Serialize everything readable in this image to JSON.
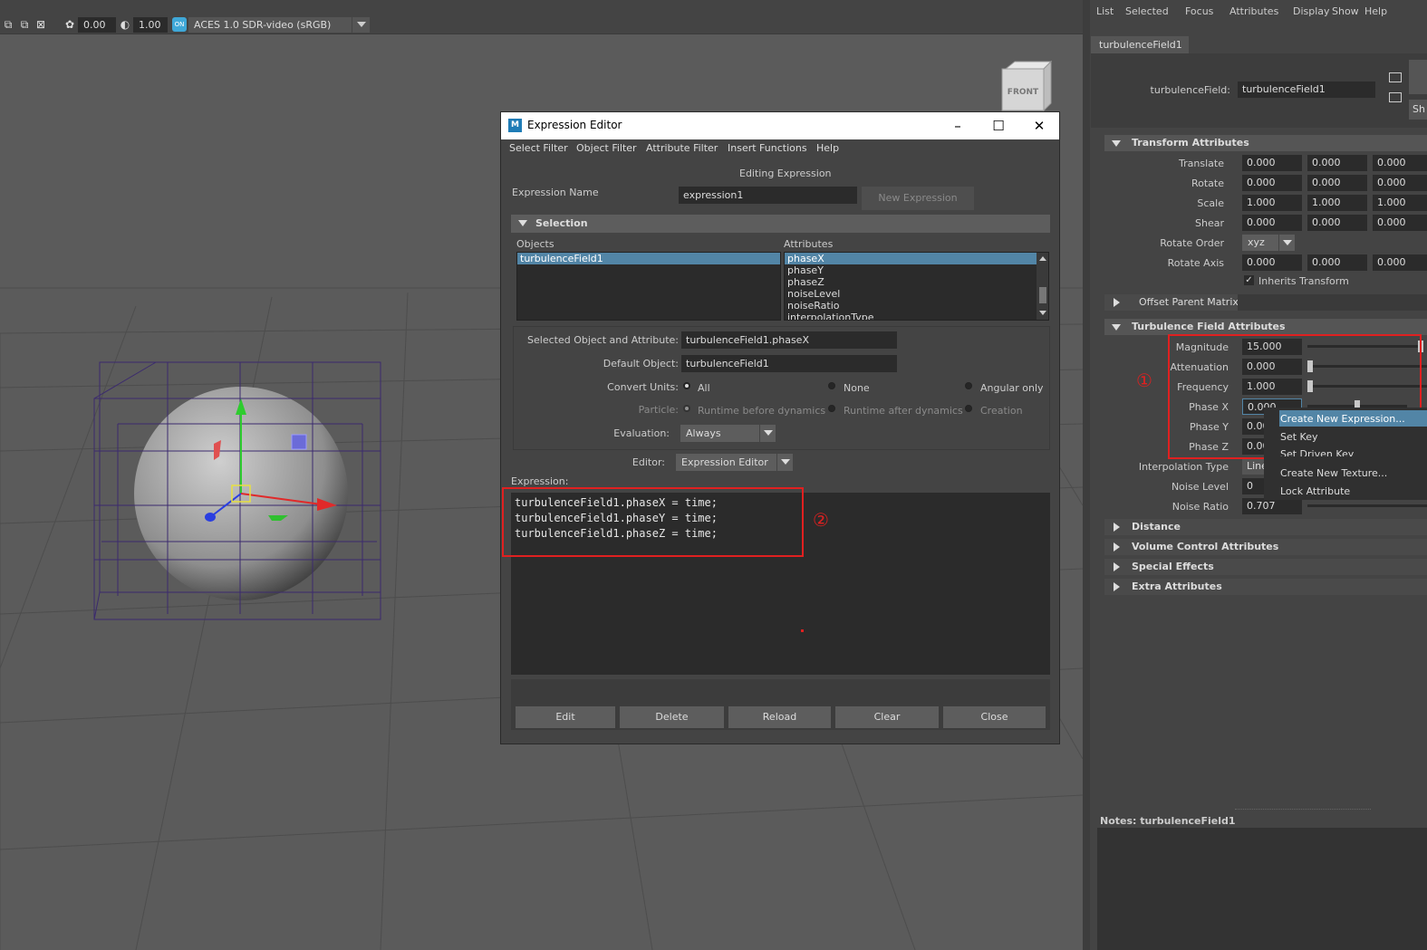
{
  "viewport": {
    "toolbar": {
      "exposure_value": "0.00",
      "gamma_value": "1.00",
      "color_space": "ACES 1.0 SDR-video (sRGB)"
    },
    "view_cube_label": "FRONT"
  },
  "expression_editor": {
    "title": "Expression Editor",
    "menu": [
      "Select Filter",
      "Object Filter",
      "Attribute Filter",
      "Insert Functions",
      "Help"
    ],
    "editing_label": "Editing Expression",
    "expression_name_label": "Expression Name",
    "expression_name_value": "expression1",
    "new_expression_button": "New Expression",
    "selection_section": "Selection",
    "objects_label": "Objects",
    "attributes_label": "Attributes",
    "objects": [
      "turbulenceField1"
    ],
    "attributes": [
      "phaseX",
      "phaseY",
      "phaseZ",
      "noiseLevel",
      "noiseRatio",
      "interpolationType"
    ],
    "selected_obj_attr_label": "Selected Object and Attribute:",
    "selected_obj_attr_value": "turbulenceField1.phaseX",
    "default_object_label": "Default Object:",
    "default_object_value": "turbulenceField1",
    "convert_units_label": "Convert Units:",
    "convert_units_options": [
      "All",
      "None",
      "Angular only"
    ],
    "particle_label": "Particle:",
    "particle_options": [
      "Runtime before dynamics",
      "Runtime after dynamics",
      "Creation"
    ],
    "evaluation_label": "Evaluation:",
    "evaluation_value": "Always",
    "editor_label": "Editor:",
    "editor_value": "Expression Editor",
    "expression_label": "Expression:",
    "code_lines": [
      "turbulenceField1.phaseX = time;",
      "turbulenceField1.phaseY = time;",
      "turbulenceField1.phaseZ = time;"
    ],
    "buttons": [
      "Edit",
      "Delete",
      "Reload",
      "Clear",
      "Close"
    ],
    "annotation_number": "②"
  },
  "attribute_editor": {
    "menu": [
      "List",
      "Selected",
      "Focus",
      "Attributes",
      "Display",
      "Show",
      "Help"
    ],
    "tab": "turbulenceField1",
    "node_label": "turbulenceField:",
    "node_value": "turbulenceField1",
    "side_button_partial": "Sh",
    "transform_section": "Transform Attributes",
    "transform_rows": [
      {
        "label": "Translate",
        "values": [
          "0.000",
          "0.000",
          "0.000"
        ]
      },
      {
        "label": "Rotate",
        "values": [
          "0.000",
          "0.000",
          "0.000"
        ]
      },
      {
        "label": "Scale",
        "values": [
          "1.000",
          "1.000",
          "1.000"
        ]
      },
      {
        "label": "Shear",
        "values": [
          "0.000",
          "0.000",
          "0.000"
        ]
      }
    ],
    "rotate_order_label": "Rotate Order",
    "rotate_order_value": "xyz",
    "rotate_axis_label": "Rotate Axis",
    "rotate_axis_values": [
      "0.000",
      "0.000",
      "0.000"
    ],
    "inherits_transform_label": "Inherits Transform",
    "offset_parent_section": "Offset Parent Matrix",
    "turbulence_section": "Turbulence Field Attributes",
    "turbulence_rows": [
      {
        "label": "Magnitude",
        "value": "15.000",
        "slider_fraction": 1.0
      },
      {
        "label": "Attenuation",
        "value": "0.000",
        "slider_fraction": 0.0
      },
      {
        "label": "Frequency",
        "value": "1.000",
        "slider_fraction": 0.0
      },
      {
        "label": "Phase X",
        "value": "0.000",
        "slider_fraction": 0.5
      },
      {
        "label": "Phase Y",
        "value": "0.000"
      },
      {
        "label": "Phase Z",
        "value": "0.000"
      }
    ],
    "interpolation_label": "Interpolation Type",
    "interpolation_value": "Linea",
    "noise_level_label": "Noise Level",
    "noise_level_value": "0",
    "noise_ratio_label": "Noise Ratio",
    "noise_ratio_value": "0.707",
    "collapsed_sections": [
      "Distance",
      "Volume Control Attributes",
      "Special Effects",
      "Extra Attributes"
    ],
    "context_menu": [
      "Create New Expression...",
      "Set Key",
      "Set Driven Key",
      "Create New Texture...",
      "Lock Attribute"
    ],
    "annotation_number": "①",
    "notes_label": "Notes:  turbulenceField1"
  },
  "colors": {
    "selection_blue": "#5285a6",
    "annotation_red": "#e02020",
    "panel_bg": "#444444",
    "viewport_bg": "#5b5b5b"
  }
}
